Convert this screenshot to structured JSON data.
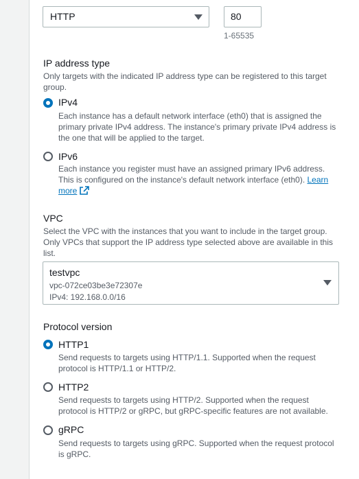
{
  "listener": {
    "protocol_value": "HTTP",
    "port_value": "80",
    "port_hint": "1-65535"
  },
  "ip_address_type": {
    "label": "IP address type",
    "description": "Only targets with the indicated IP address type can be registered to this target group.",
    "options": [
      {
        "label": "IPv4",
        "checked": true,
        "description": "Each instance has a default network interface (eth0) that is assigned the primary private IPv4 address. The instance's primary private IPv4 address is the one that will be applied to the target."
      },
      {
        "label": "IPv6",
        "checked": false,
        "description": "Each instance you register must have an assigned primary IPv6 address. This is configured on the instance's default network interface (eth0).",
        "link_text": "Learn more"
      }
    ]
  },
  "vpc": {
    "label": "VPC",
    "description": "Select the VPC with the instances that you want to include in the target group. Only VPCs that support the IP address type selected above are available in this list.",
    "selected_name": "testvpc",
    "selected_id": "vpc-072ce03be3e72307e",
    "selected_cidr": "IPv4: 192.168.0.0/16"
  },
  "protocol_version": {
    "label": "Protocol version",
    "options": [
      {
        "label": "HTTP1",
        "checked": true,
        "description": "Send requests to targets using HTTP/1.1. Supported when the request protocol is HTTP/1.1 or HTTP/2."
      },
      {
        "label": "HTTP2",
        "checked": false,
        "description": "Send requests to targets using HTTP/2. Supported when the request protocol is HTTP/2 or gRPC, but gRPC-specific features are not available."
      },
      {
        "label": "gRPC",
        "checked": false,
        "description": "Send requests to targets using gRPC. Supported when the request protocol is gRPC."
      }
    ]
  },
  "colors": {
    "accent": "#0073bb",
    "text": "#16191f",
    "muted": "#545b64",
    "border": "#aab7b8"
  },
  "icons": {
    "caret": "caret-down-icon",
    "external": "external-link-icon"
  }
}
